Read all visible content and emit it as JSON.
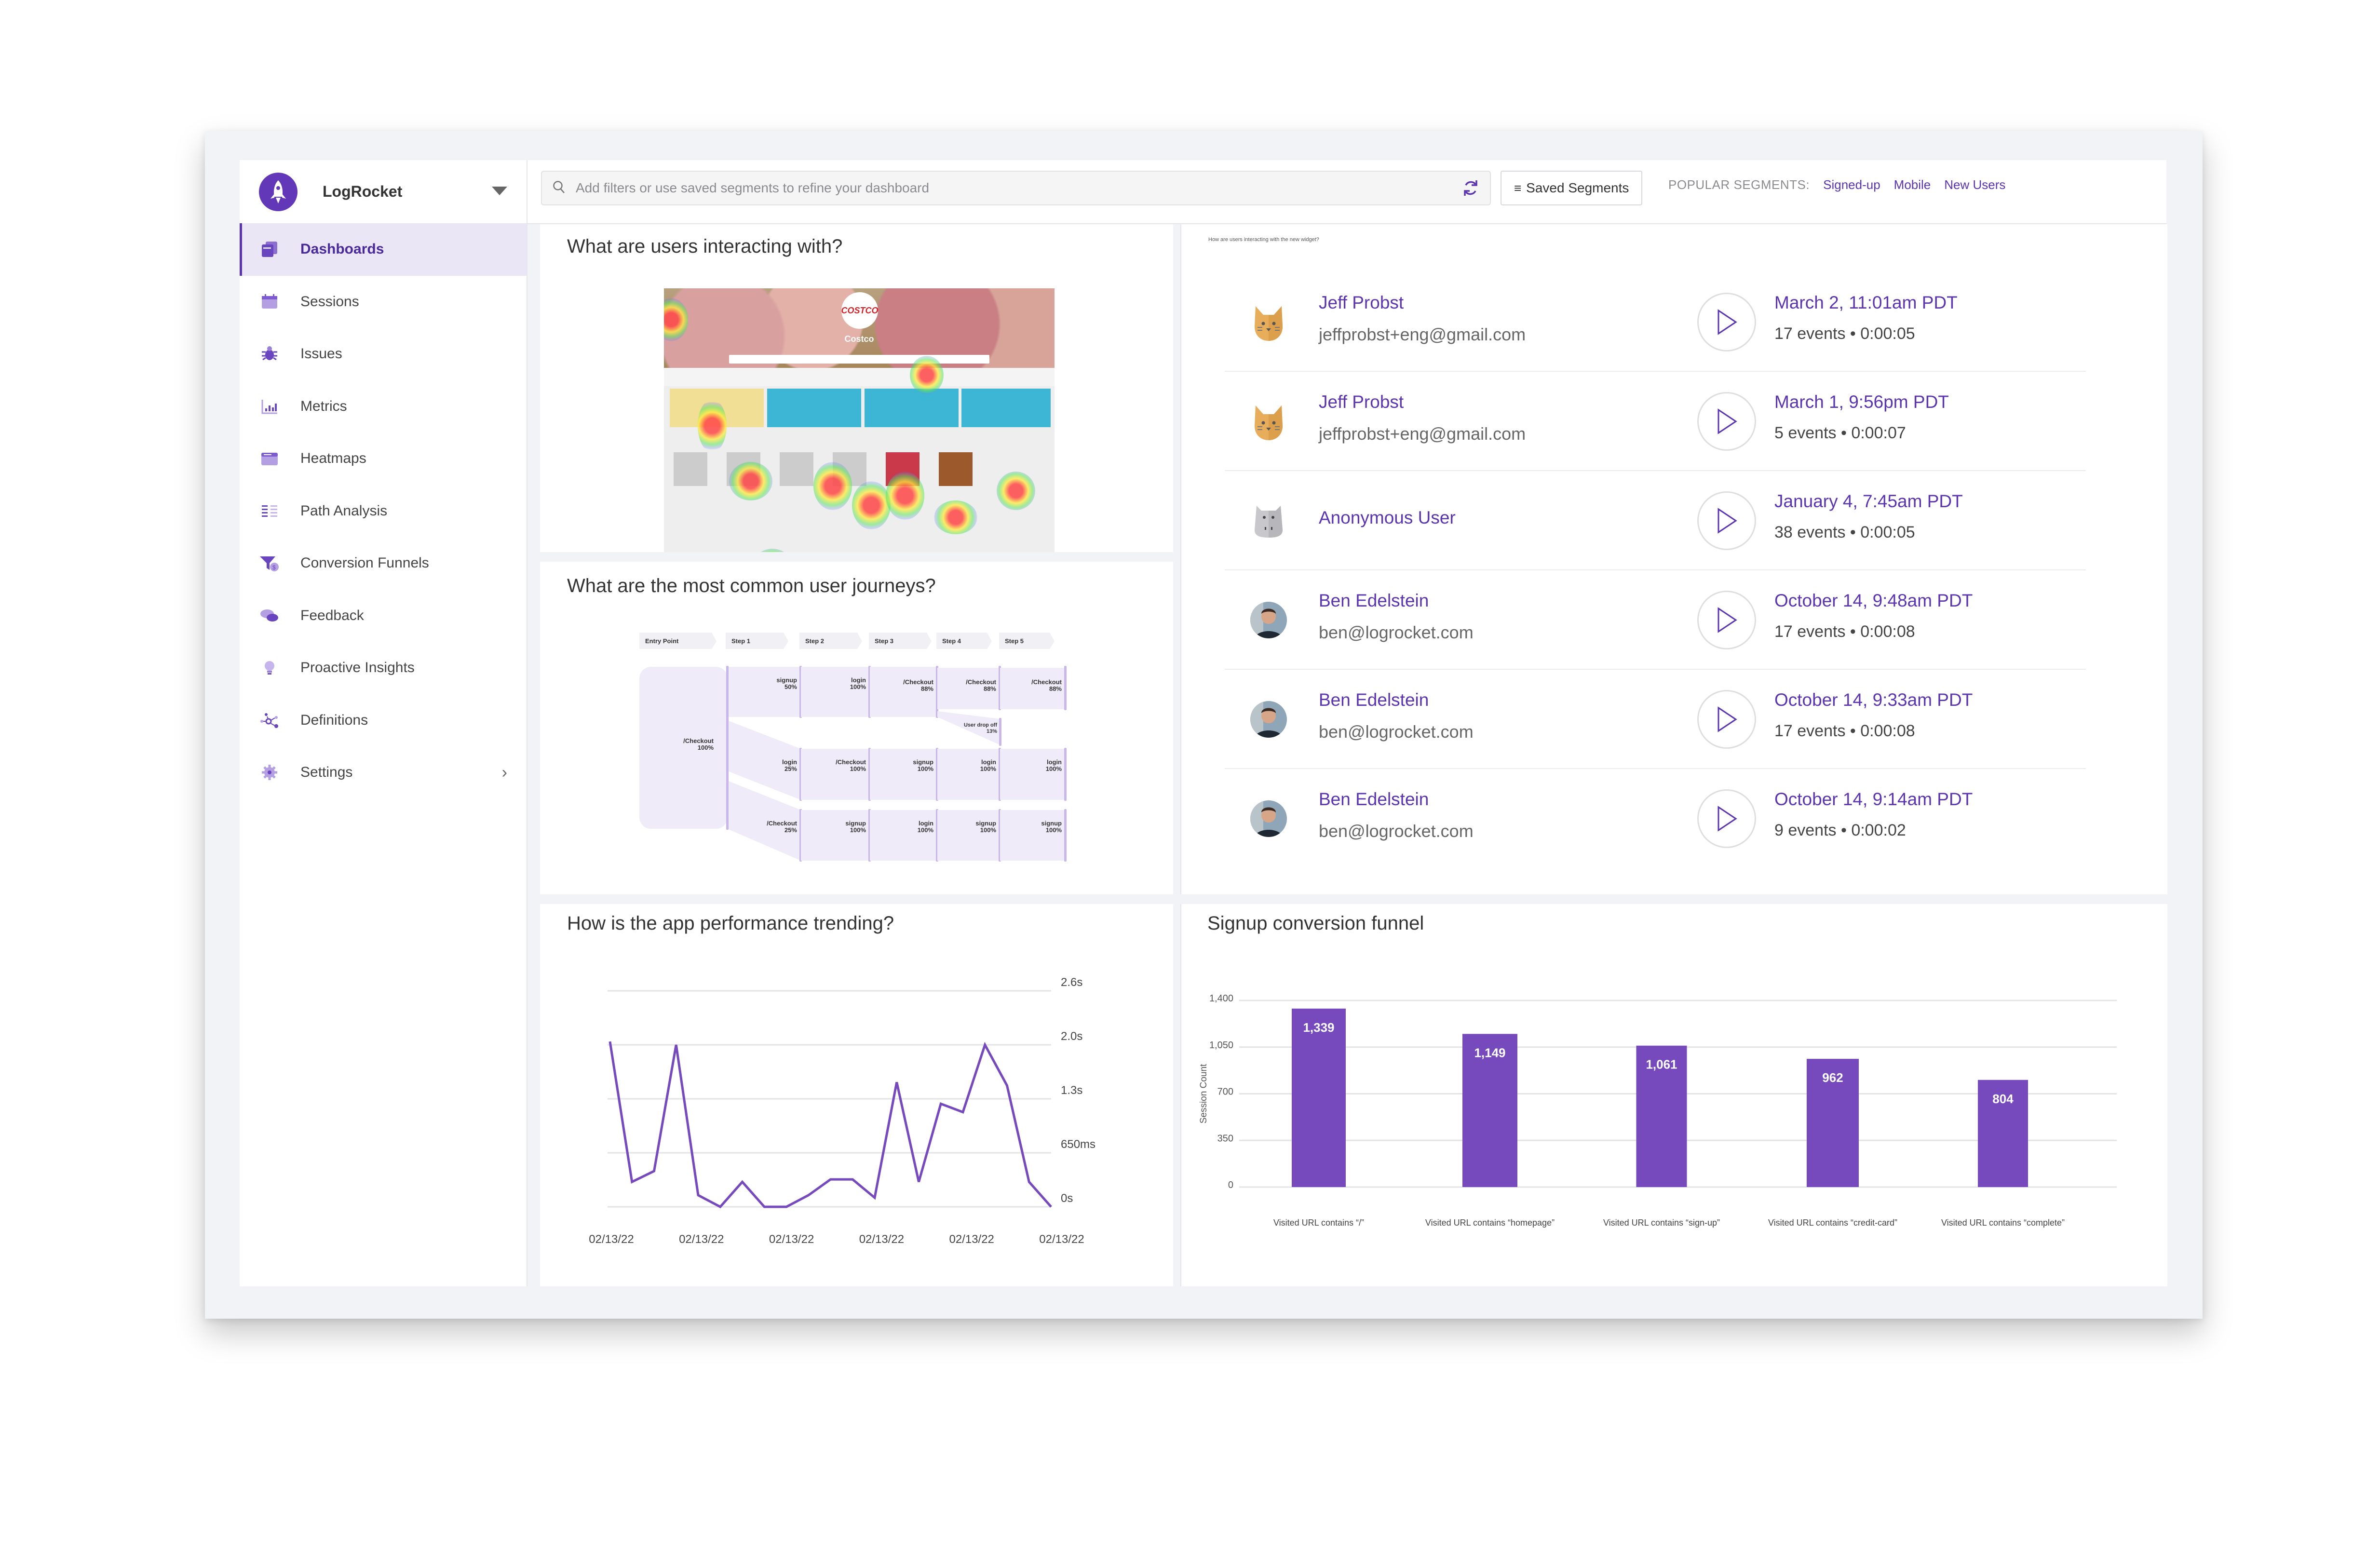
{
  "sidebar": {
    "brand": "LogRocket",
    "items": [
      {
        "label": "Dashboards",
        "icon": "dashboards-icon",
        "active": true
      },
      {
        "label": "Sessions",
        "icon": "calendar-icon"
      },
      {
        "label": "Issues",
        "icon": "bug-icon"
      },
      {
        "label": "Metrics",
        "icon": "bar-chart-icon"
      },
      {
        "label": "Heatmaps",
        "icon": "browser-window-icon"
      },
      {
        "label": "Path Analysis",
        "icon": "list-columns-icon"
      },
      {
        "label": "Conversion Funnels",
        "icon": "funnel-dollar-icon"
      },
      {
        "label": "Feedback",
        "icon": "chat-bubbles-icon"
      },
      {
        "label": "Proactive Insights",
        "icon": "lightbulb-icon"
      },
      {
        "label": "Definitions",
        "icon": "nodes-icon"
      },
      {
        "label": "Settings",
        "icon": "gear-icon",
        "has_submenu": true
      }
    ]
  },
  "topbar": {
    "search_placeholder": "Add filters or use saved segments to refine your dashboard",
    "saved_segments_label": "Saved Segments",
    "popular_label": "POPULAR SEGMENTS:",
    "popular_segments": [
      "Signed-up",
      "Mobile",
      "New Users"
    ]
  },
  "panels": {
    "heatmap": {
      "title": "What are users interacting with?",
      "store_name": "Costco",
      "store_logo": "COSTCO"
    },
    "journeys": {
      "title": "What are the most common user journeys?",
      "steps": [
        "Entry Point",
        "Step 1",
        "Step 2",
        "Step 3",
        "Step 4",
        "Step 5"
      ],
      "entry": {
        "label": "/Checkout",
        "pct": "100%"
      },
      "paths": [
        {
          "nodes": [
            {
              "label": "signup",
              "pct": "50%"
            },
            {
              "label": "login",
              "pct": "100%"
            },
            {
              "label": "/Checkout",
              "pct": "88%"
            },
            {
              "label": "/Checkout",
              "pct": "88%"
            },
            {
              "label": "/Checkout",
              "pct": "88%"
            }
          ],
          "dropoff": {
            "label": "User drop off",
            "pct": "13%"
          }
        },
        {
          "nodes": [
            {
              "label": "login",
              "pct": "25%"
            },
            {
              "label": "/Checkout",
              "pct": "100%"
            },
            {
              "label": "signup",
              "pct": "100%"
            },
            {
              "label": "login",
              "pct": "100%"
            },
            {
              "label": "login",
              "pct": "100%"
            }
          ]
        },
        {
          "nodes": [
            {
              "label": "/Checkout",
              "pct": "25%"
            },
            {
              "label": "signup",
              "pct": "100%"
            },
            {
              "label": "login",
              "pct": "100%"
            },
            {
              "label": "signup",
              "pct": "100%"
            },
            {
              "label": "signup",
              "pct": "100%"
            }
          ]
        }
      ]
    },
    "sessions": {
      "widget_note": "How are users interacting with the new widget?",
      "rows": [
        {
          "name": "Jeff Probst",
          "email": "jeffprobst+eng@gmail.com",
          "avatar": "cat-avatar-icon",
          "date": "March 2, 11:01am PDT",
          "meta": "17 events • 0:00:05"
        },
        {
          "name": "Jeff Probst",
          "email": "jeffprobst+eng@gmail.com",
          "avatar": "cat-avatar-icon",
          "date": "March 1, 9:56pm PDT",
          "meta": "5 events • 0:00:07"
        },
        {
          "name": "Anonymous User",
          "email": "",
          "avatar": "hippo-avatar-icon",
          "date": "January 4, 7:45am PDT",
          "meta": "38 events • 0:00:05"
        },
        {
          "name": "Ben Edelstein",
          "email": "ben@logrocket.com",
          "avatar": "photo-avatar",
          "date": "October 14, 9:48am PDT",
          "meta": "17 events • 0:00:08"
        },
        {
          "name": "Ben Edelstein",
          "email": "ben@logrocket.com",
          "avatar": "photo-avatar",
          "date": "October 14, 9:33am PDT",
          "meta": "17 events • 0:00:08"
        },
        {
          "name": "Ben Edelstein",
          "email": "ben@logrocket.com",
          "avatar": "photo-avatar",
          "date": "October 14, 9:14am PDT",
          "meta": "9 events • 0:00:02"
        }
      ]
    }
  },
  "colors": {
    "accent": "#5b34b0",
    "bar": "#764abc",
    "line": "#764abc",
    "grid": "#e4e4e6",
    "active_bg": "#ebe6f6",
    "frame_bg": "#f2f3f7"
  },
  "chart_data": [
    {
      "type": "line",
      "title": "How is the app performance trending?",
      "xlabel": "",
      "ylabel": "",
      "x_tick_labels": [
        "02/13/22",
        "02/13/22",
        "02/13/22",
        "02/13/22",
        "02/13/22",
        "02/13/22"
      ],
      "y_ticks": [
        0,
        650,
        1300,
        1950,
        2600
      ],
      "y_tick_labels": [
        "0s",
        "650ms",
        "1.3s",
        "2.0s",
        "2.6s"
      ],
      "ylim": [
        0,
        2600
      ],
      "y_axis_side": "right",
      "grid": true,
      "series": [
        {
          "name": "performance_ms",
          "values": [
            1990,
            300,
            430,
            1950,
            140,
            0,
            300,
            0,
            0,
            140,
            330,
            330,
            110,
            1500,
            300,
            1240,
            1140,
            1950,
            1460,
            300,
            0
          ]
        }
      ]
    },
    {
      "type": "bar",
      "title": "Signup conversion funnel",
      "xlabel": "",
      "ylabel": "Session Count",
      "categories": [
        "Visited URL contains “/”",
        "Visited URL contains “homepage”",
        "Visited URL contains “sign-up”",
        "Visited URL contains “credit-card”",
        "Visited URL contains “complete”"
      ],
      "values": [
        1339,
        1149,
        1061,
        962,
        804
      ],
      "value_labels": [
        "1,339",
        "1,149",
        "1,061",
        "962",
        "804"
      ],
      "y_ticks": [
        0,
        350,
        700,
        1050,
        1400
      ],
      "y_tick_labels": [
        "0",
        "350",
        "700",
        "1,050",
        "1,400"
      ],
      "ylim": [
        0,
        1400
      ],
      "grid": true
    }
  ]
}
